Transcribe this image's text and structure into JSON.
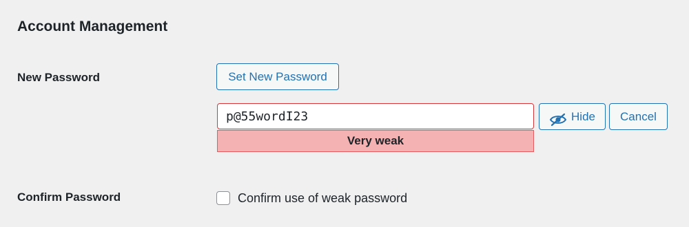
{
  "section": {
    "title": "Account Management"
  },
  "new_password": {
    "label": "New Password",
    "set_button_label": "Set New Password",
    "input_value": "p@55wordI23",
    "strength_label": "Very weak",
    "hide_button_label": "Hide",
    "hide_icon": "eye-slash-icon",
    "cancel_button_label": "Cancel"
  },
  "confirm_password": {
    "label": "Confirm Password",
    "checkbox_label": "Confirm use of weak password",
    "checked": false
  },
  "colors": {
    "accent": "#2271b1",
    "error_border": "#d63638",
    "weak_background": "#f5b2b3",
    "page_background": "#f0f0f1"
  }
}
